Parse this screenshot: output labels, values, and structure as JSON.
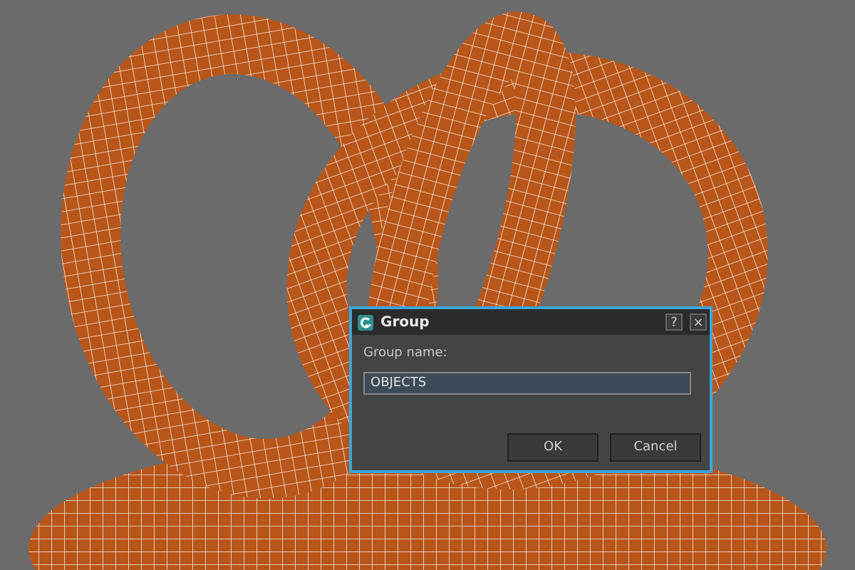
{
  "dialog": {
    "title": "Group",
    "help_button": "?",
    "close_button": "×",
    "field_label": "Group name:",
    "field_value": "OBJECTS",
    "buttons": [
      {
        "label": "OK"
      },
      {
        "label": "Cancel"
      }
    ]
  }
}
